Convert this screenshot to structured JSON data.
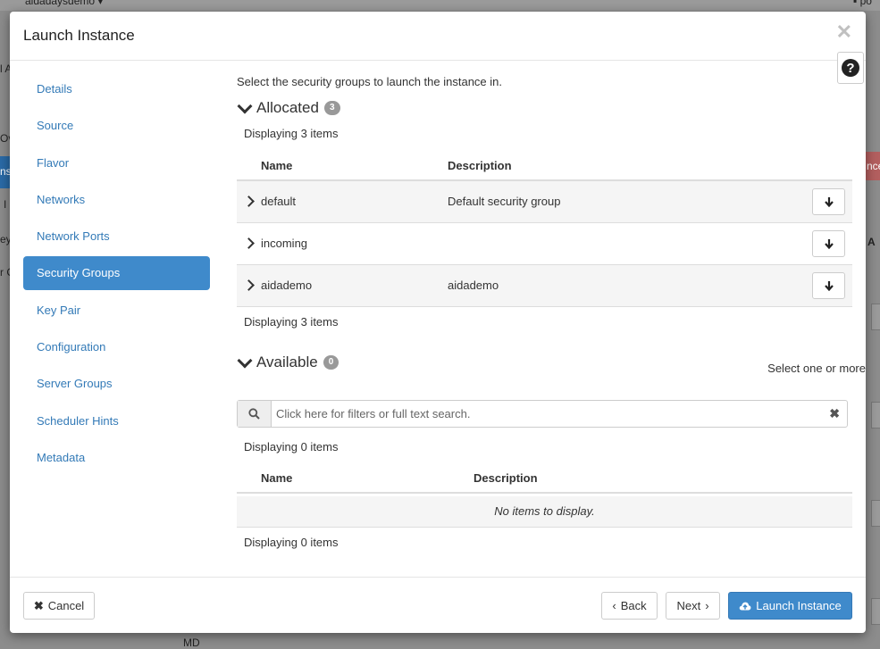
{
  "background": {
    "project_name": "aidadaysdemo",
    "fragments": [
      "l A",
      "Ov",
      "ns",
      "I",
      "ey",
      "r C",
      "A",
      "nce",
      "MD",
      "po"
    ]
  },
  "modal": {
    "title": "Launch Instance",
    "close_icon": "close-icon",
    "help_icon": "question-circle-icon"
  },
  "sidebar": {
    "items": [
      {
        "label": "Details"
      },
      {
        "label": "Source"
      },
      {
        "label": "Flavor"
      },
      {
        "label": "Networks"
      },
      {
        "label": "Network Ports"
      },
      {
        "label": "Security Groups",
        "active": true
      },
      {
        "label": "Key Pair"
      },
      {
        "label": "Configuration"
      },
      {
        "label": "Server Groups"
      },
      {
        "label": "Scheduler Hints"
      },
      {
        "label": "Metadata"
      }
    ]
  },
  "main": {
    "intro": "Select the security groups to launch the instance in.",
    "allocated": {
      "title": "Allocated",
      "count": "3",
      "displaying_top": "Displaying 3 items",
      "displaying_bottom": "Displaying 3 items",
      "columns": {
        "name": "Name",
        "description": "Description"
      },
      "rows": [
        {
          "name": "default",
          "description": "Default security group"
        },
        {
          "name": "incoming",
          "description": ""
        },
        {
          "name": "aidademo",
          "description": "aidademo"
        }
      ]
    },
    "available": {
      "title": "Available",
      "count": "0",
      "select_hint": "Select one or more",
      "search_placeholder": "Click here for filters or full text search.",
      "displaying_top": "Displaying 0 items",
      "displaying_bottom": "Displaying 0 items",
      "columns": {
        "name": "Name",
        "description": "Description"
      },
      "empty_text": "No items to display."
    }
  },
  "footer": {
    "cancel_label": "Cancel",
    "back_label": "Back",
    "next_label": "Next",
    "launch_label": "Launch Instance"
  },
  "colors": {
    "accent": "#3f8acb",
    "link": "#337ab7",
    "badge": "#999999"
  }
}
